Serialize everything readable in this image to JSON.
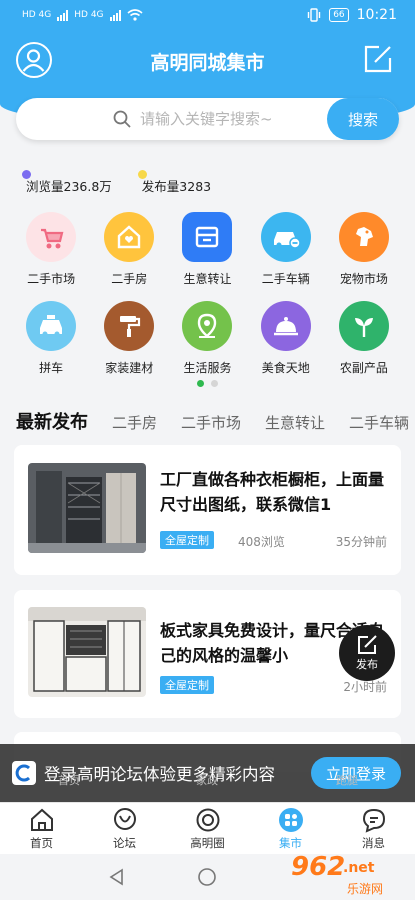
{
  "status_bar": {
    "network_left": "HD 4G",
    "network_right": "HD 4G",
    "battery": "66",
    "time": "10:21"
  },
  "header": {
    "title": "高明同城集市"
  },
  "search": {
    "placeholder": "请输入关键字搜索~",
    "button_label": "搜索"
  },
  "stats": {
    "views": "浏览量236.8万",
    "posts": "发布量3283",
    "views_dot_color": "#7b6cf0",
    "posts_dot_color": "#f7d84a"
  },
  "categories": [
    {
      "label": "二手市场",
      "icon": "stroller-icon",
      "color": "#fde3e6"
    },
    {
      "label": "二手房",
      "icon": "house-heart-icon",
      "color": "#ffc43d"
    },
    {
      "label": "生意转让",
      "icon": "shop-icon",
      "color": "#2f7cf6"
    },
    {
      "label": "二手车辆",
      "icon": "car-icon",
      "color": "#3cb6f0"
    },
    {
      "label": "宠物市场",
      "icon": "dog-icon",
      "color": "#ff8a2a"
    },
    {
      "label": "拼车",
      "icon": "taxi-icon",
      "color": "#6fcaf2"
    },
    {
      "label": "家装建材",
      "icon": "paint-roller-icon",
      "color": "#a45a2e"
    },
    {
      "label": "生活服务",
      "icon": "location-pin-icon",
      "color": "#74c24b"
    },
    {
      "label": "美食天地",
      "icon": "food-cloche-icon",
      "color": "#8c66e0"
    },
    {
      "label": "农副产品",
      "icon": "sprout-icon",
      "color": "#2fb36b"
    }
  ],
  "tabs": [
    "最新发布",
    "二手房",
    "二手市场",
    "生意转让",
    "二手车辆"
  ],
  "posts": [
    {
      "title": "工厂直做各种衣柜橱柜，上面量尺寸出图纸，联系微信1",
      "tag": "全屋定制",
      "views": "408浏览",
      "time": "35分钟前"
    },
    {
      "title": "板式家具免费设计，量尺合适自己的风格的温馨小",
      "tag": "全屋定制",
      "views": "",
      "time": "2小时前"
    }
  ],
  "fab": {
    "label": "发布"
  },
  "login_banner": {
    "text": "登录高明论坛体验更多精彩内容",
    "button_label": "立即登录"
  },
  "ghost_labels": [
    "首页",
    "家政",
    "跑腿"
  ],
  "bottom_nav": [
    {
      "label": "首页",
      "icon": "home-icon",
      "active": false
    },
    {
      "label": "论坛",
      "icon": "forum-icon",
      "active": false
    },
    {
      "label": "高明圈",
      "icon": "circle-icon",
      "active": false
    },
    {
      "label": "集市",
      "icon": "market-icon",
      "active": true
    },
    {
      "label": "消息",
      "icon": "message-icon",
      "active": false
    }
  ],
  "watermark": {
    "number": "962",
    "suffix": ".net",
    "site": "乐游网"
  },
  "colors": {
    "primary": "#3aaef3",
    "active_dot": "#2fb94f"
  }
}
